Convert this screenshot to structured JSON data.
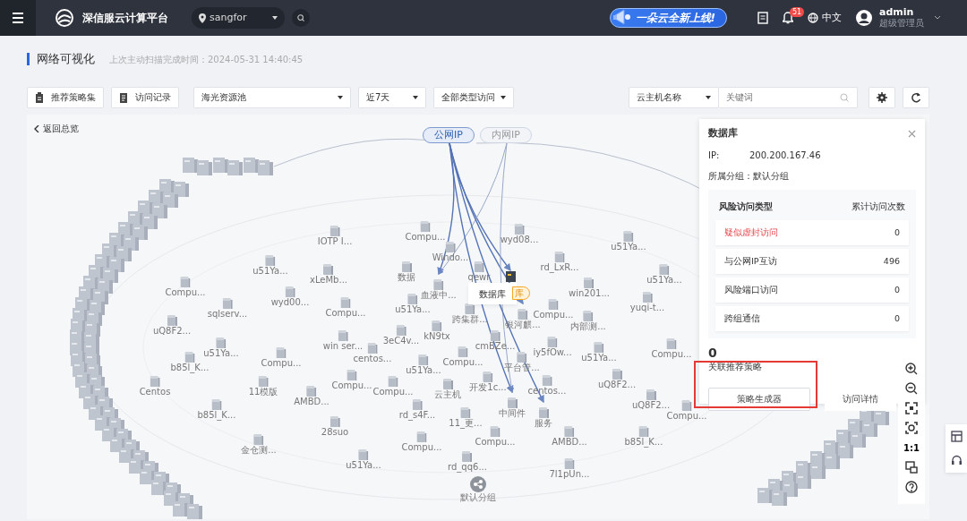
{
  "header": {
    "brand": "深信服云计算平台",
    "location": "sangfor",
    "banner": "一朵云全新上线!",
    "notification_count": "51",
    "language": "中文",
    "user": {
      "name": "admin",
      "role": "超级管理员"
    }
  },
  "page": {
    "title": "网络可视化",
    "scan_time": "上次主动扫描完成时间：2024-05-31 14:40:45"
  },
  "toolbar": {
    "buttons": [
      "推荐策略集",
      "访问记录"
    ],
    "filters": [
      "海光资源池",
      "近7天",
      "全部类型访问"
    ],
    "search_type": "云主机名称",
    "search": {
      "placeholder": "关键词"
    }
  },
  "canvas": {
    "back_link": "返回总览",
    "ip_tabs": [
      {
        "label": "公网IP",
        "selected": true
      },
      {
        "label": "内网IP",
        "selected": false
      }
    ],
    "server_stacks": [
      {
        "linked": true
      },
      {
        "linked": true
      }
    ],
    "tooltip": {
      "label": "数据库",
      "tag": "库"
    },
    "nodes": [
      {
        "label": "IOTP I...",
        "kind": "host"
      },
      {
        "label": "Compu...",
        "kind": "host"
      },
      {
        "label": "wyd08...",
        "kind": "host"
      },
      {
        "label": "u51Ya...",
        "kind": "host"
      },
      {
        "label": "u51Ya...",
        "kind": "host"
      },
      {
        "label": "xLeMb...",
        "kind": "host"
      },
      {
        "label": "数据",
        "kind": "host"
      },
      {
        "label": "Windo...",
        "kind": "host"
      },
      {
        "label": "qewr",
        "kind": "host"
      },
      {
        "label": "rd_LxR...",
        "kind": "host"
      },
      {
        "label": "u51Ya...",
        "kind": "host"
      },
      {
        "label": "Compu...",
        "kind": "host"
      },
      {
        "label": "wyd00...",
        "kind": "host"
      },
      {
        "label": "Compu...",
        "kind": "host"
      },
      {
        "label": "血液中...",
        "kind": "host",
        "public_link": true,
        "private_link": true
      },
      {
        "label": "win201...",
        "kind": "host"
      },
      {
        "label": "yuqi-t...",
        "kind": "host"
      },
      {
        "label": "sqlserv...",
        "kind": "host"
      },
      {
        "label": "u51Ya...",
        "kind": "host"
      },
      {
        "label": "跨集群...",
        "kind": "host"
      },
      {
        "label": "银河麒...",
        "kind": "host",
        "public_link": true
      },
      {
        "label": "Compu...",
        "kind": "host"
      },
      {
        "label": "内部测...",
        "kind": "host"
      },
      {
        "label": "uQ8F2...",
        "kind": "host"
      },
      {
        "label": "3eC4v...",
        "kind": "host"
      },
      {
        "label": "kN9tx",
        "kind": "host"
      },
      {
        "label": "win ser...",
        "kind": "host"
      },
      {
        "label": "cmBZe...",
        "kind": "host"
      },
      {
        "label": "centos...",
        "kind": "host"
      },
      {
        "label": "u51Ya...",
        "kind": "host"
      },
      {
        "label": "iy5fOw...",
        "kind": "host"
      },
      {
        "label": "u51Ya...",
        "kind": "host"
      },
      {
        "label": "Compu...",
        "kind": "host"
      },
      {
        "label": "b85l_K...",
        "kind": "host"
      },
      {
        "label": "Compu...",
        "kind": "host"
      },
      {
        "label": "u51Ya...",
        "kind": "host"
      },
      {
        "label": "Compu...",
        "kind": "host"
      },
      {
        "label": "平台管...",
        "kind": "host"
      },
      {
        "label": "Compu...",
        "kind": "host"
      },
      {
        "label": "Compu...",
        "kind": "host"
      },
      {
        "label": "开发1c...",
        "kind": "host"
      },
      {
        "label": "centos...",
        "kind": "host"
      },
      {
        "label": "uQ8F2...",
        "kind": "host"
      },
      {
        "label": "Centos",
        "kind": "host"
      },
      {
        "label": "11模版",
        "kind": "host"
      },
      {
        "label": "AMBD...",
        "kind": "host"
      },
      {
        "label": "云主机",
        "kind": "host"
      },
      {
        "label": "uQ8F2...",
        "kind": "host"
      },
      {
        "label": "b85l_K...",
        "kind": "host"
      },
      {
        "label": "rd_s4F...",
        "kind": "host"
      },
      {
        "label": "中间件",
        "kind": "host",
        "public_link": true,
        "private_link": true
      },
      {
        "label": "服务",
        "kind": "host",
        "public_link": true
      },
      {
        "label": "11_更...",
        "kind": "host"
      },
      {
        "label": "28suo",
        "kind": "host"
      },
      {
        "label": "Compu...",
        "kind": "host"
      },
      {
        "label": "Compu...",
        "kind": "host"
      },
      {
        "label": "Compu...",
        "kind": "host"
      },
      {
        "label": "AMBD...",
        "kind": "host"
      },
      {
        "label": "b85l_K...",
        "kind": "host"
      },
      {
        "label": "金仓测...",
        "kind": "host"
      },
      {
        "label": "u51Ya...",
        "kind": "host"
      },
      {
        "label": "rd_qq6...",
        "kind": "host"
      },
      {
        "label": "7l1pUn...",
        "kind": "host"
      },
      {
        "label": "默认分组",
        "kind": "group"
      }
    ]
  },
  "detail_panel": {
    "title": "数据库",
    "ip_label": "IP:",
    "ip": "200.200.167.46",
    "group_label": "所属分组：",
    "group": "默认分组",
    "columns": [
      "风险访问类型",
      "累计访问次数"
    ],
    "rows": [
      {
        "type": "疑似虚封访问",
        "count": "0",
        "alert": true
      },
      {
        "type": "与公网IP互访",
        "count": "496",
        "alert": false
      },
      {
        "type": "风险端口访问",
        "count": "0",
        "alert": false
      },
      {
        "type": "跨组通信",
        "count": "0",
        "alert": false
      }
    ],
    "policy_count": "0",
    "policy_label": "关联推荐策略",
    "buttons": [
      {
        "label": "策略生成器",
        "highlighted": true
      },
      {
        "label": "访问详情",
        "highlighted": false
      }
    ]
  },
  "zoom_tools": {
    "ratio_label": "1:1"
  }
}
